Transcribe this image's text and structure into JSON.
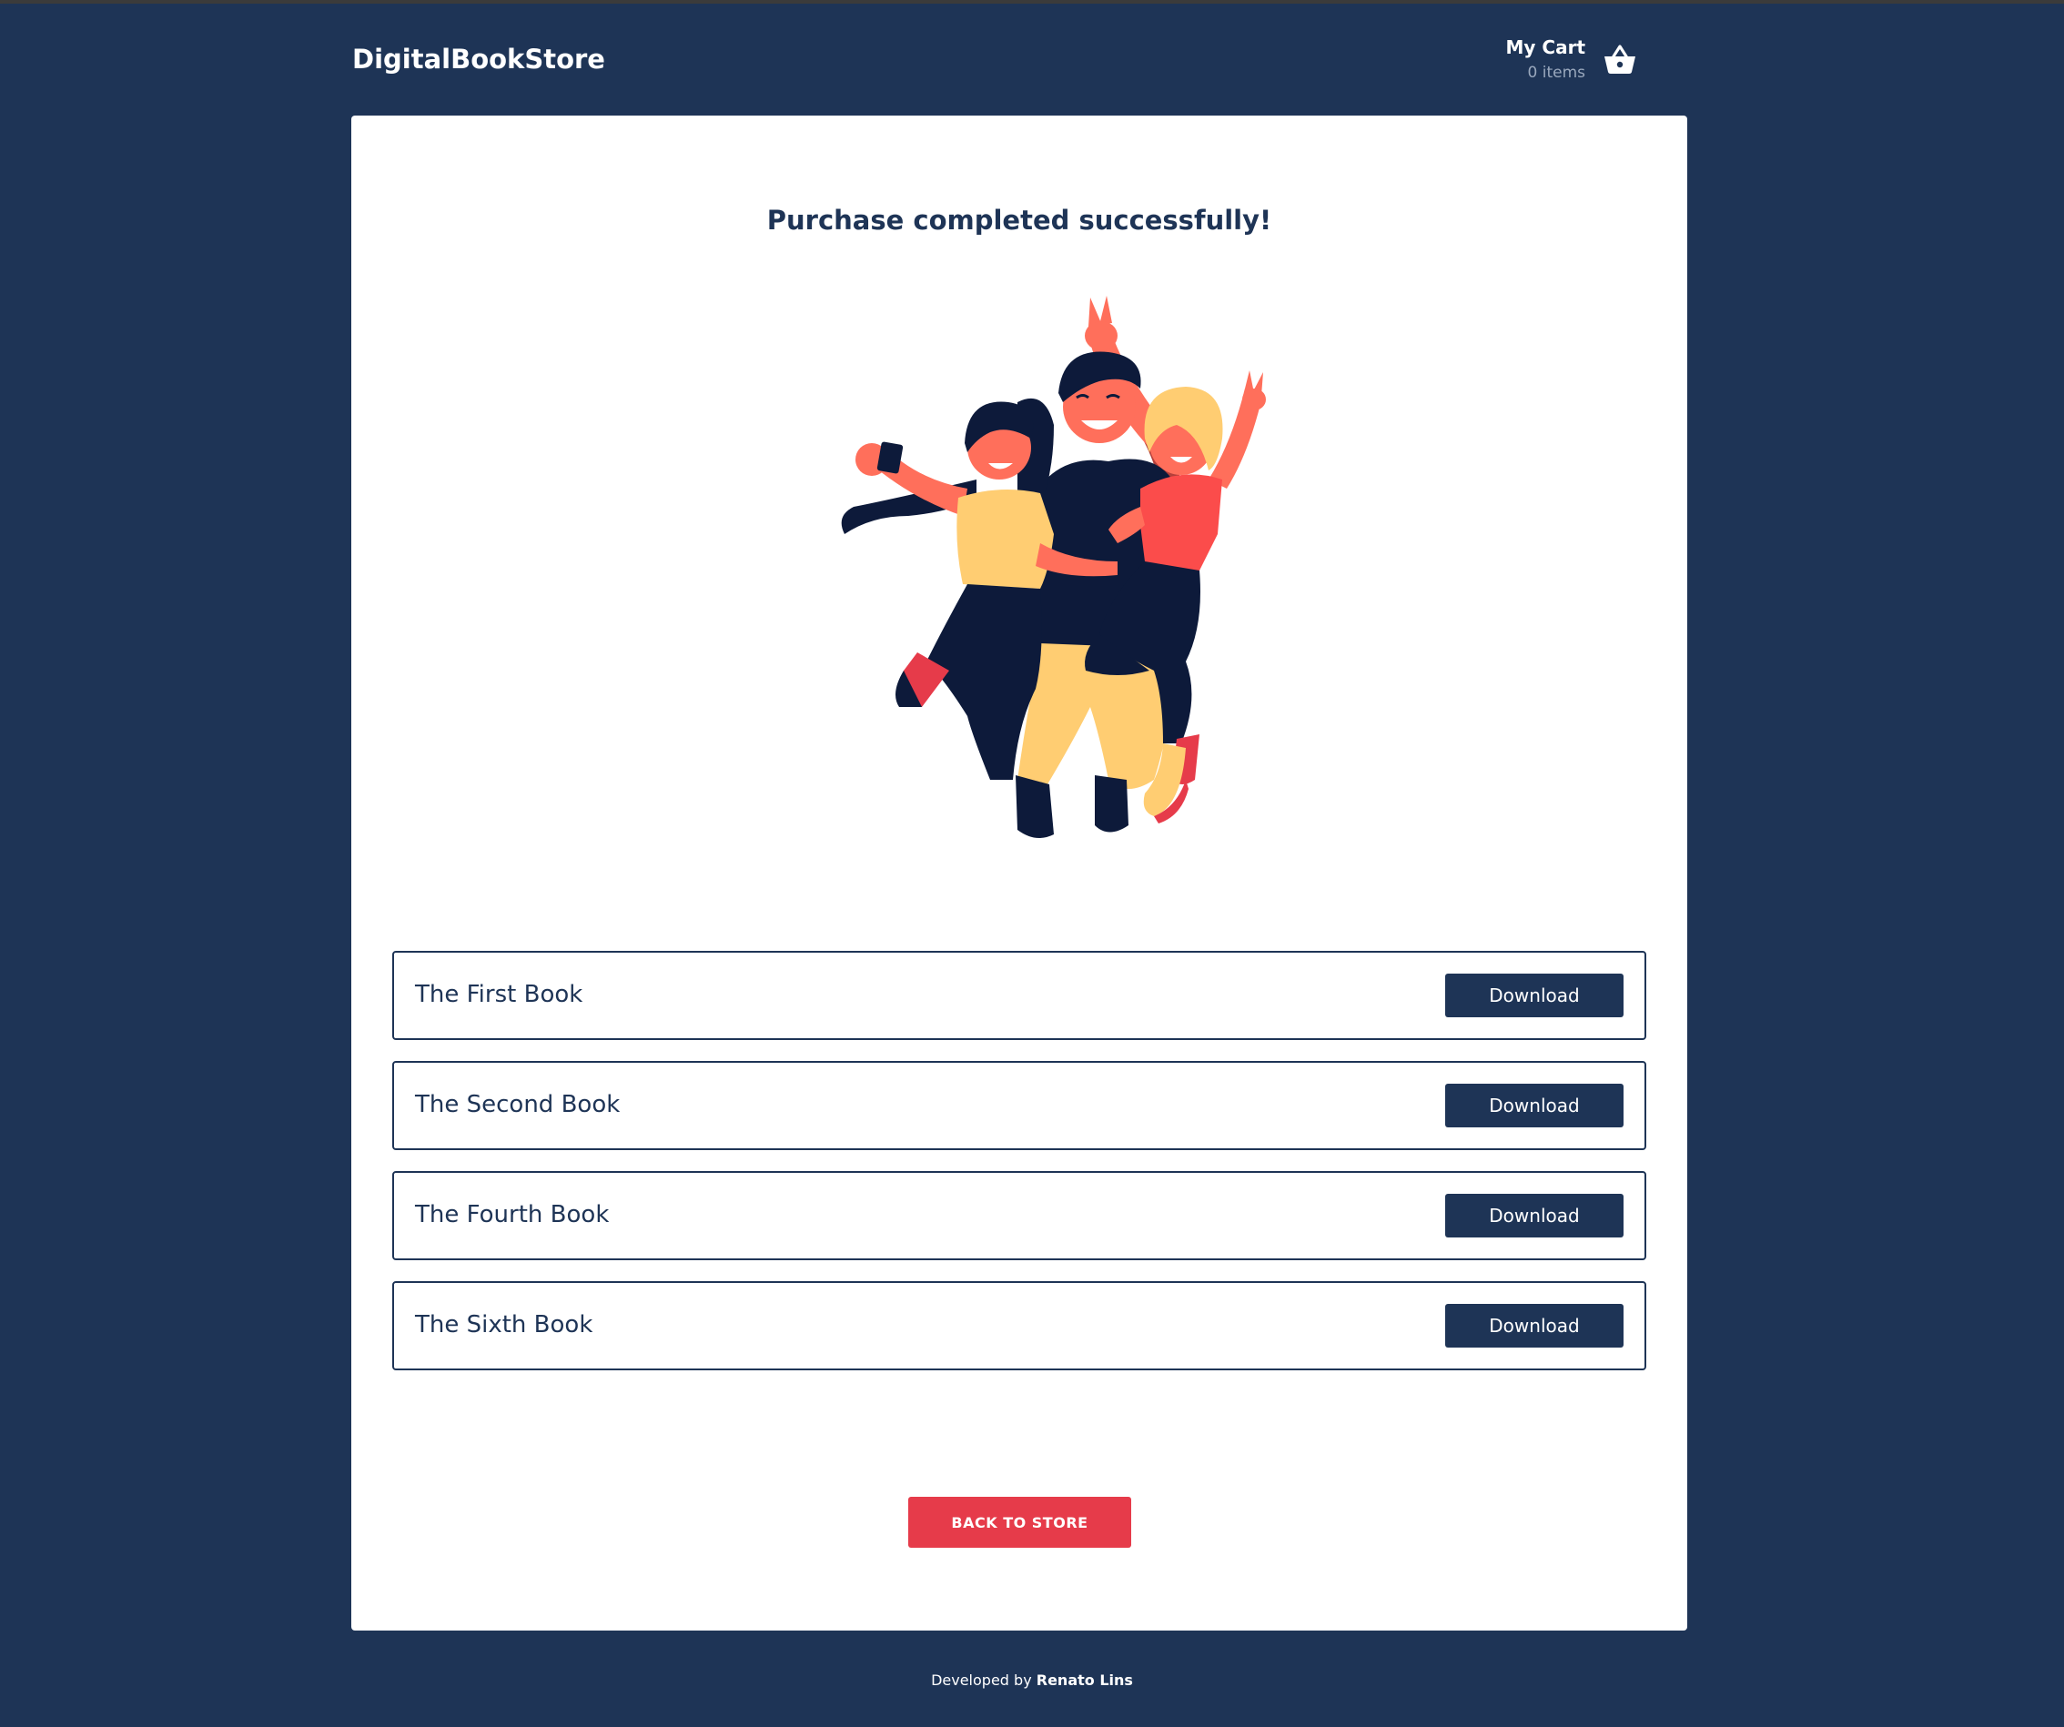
{
  "header": {
    "brand": "DigitalBookStore",
    "cart": {
      "title": "My Cart",
      "count": "0 items",
      "icon": "basket-icon"
    }
  },
  "main": {
    "title": "Purchase completed successfully!",
    "illustration": "friends-celebrating-illustration",
    "books": [
      {
        "title": "The First Book",
        "action": "Download"
      },
      {
        "title": "The Second Book",
        "action": "Download"
      },
      {
        "title": "The Fourth Book",
        "action": "Download"
      },
      {
        "title": "The Sixth Book",
        "action": "Download"
      }
    ],
    "back_button": "BACK TO STORE"
  },
  "footer": {
    "prefix": "Developed by",
    "author": "Renato Lins"
  },
  "colors": {
    "background": "#1e3456",
    "card": "#ffffff",
    "primary": "#1e3456",
    "accent": "#e63b4a"
  }
}
